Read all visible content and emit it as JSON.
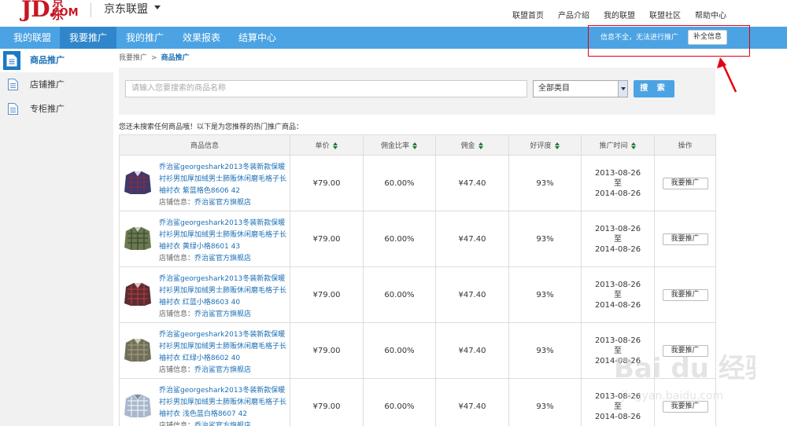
{
  "header": {
    "logo_jd": "JD.",
    "logo_cn": "京东",
    "logo_com": "COM",
    "site_title": "京东联盟",
    "links": [
      "联盟首页",
      "产品介绍",
      "我的联盟",
      "联盟社区",
      "帮助中心"
    ]
  },
  "nav": {
    "items": [
      "我的联盟",
      "我要推广",
      "我的推广",
      "效果报表",
      "结算中心"
    ],
    "active": "我要推广",
    "warning": "信息不全，无法进行推广",
    "complete_info_button": "补全信息"
  },
  "sidebar": {
    "items": [
      "商品推广",
      "店铺推广",
      "专柜推广"
    ],
    "active": "商品推广"
  },
  "breadcrumb": {
    "parent": "我要推广",
    "separator": ">",
    "current": "商品推广"
  },
  "search": {
    "placeholder": "请输入您要搜索的商品名称",
    "category": "全部类目",
    "button": "搜 索"
  },
  "hint": "您还未搜索任何商品哦！以下是为您推荐的热门推广商品：",
  "table": {
    "headers": [
      "商品信息",
      "单价",
      "佣金比率",
      "佣金",
      "好评度",
      "推广时间",
      "操作"
    ],
    "rows": [
      {
        "name": "乔治鲨georgeshark2013冬装新款保暖衬衫男加厚加绒男士肺贩休闲磨毛格子长袖衬衣 紫蓝格色8606 42",
        "store_label": "店铺信息：",
        "store": "乔治鲨官方旗舰店",
        "price": "¥79.00",
        "rate": "60.00%",
        "commission": "¥47.40",
        "rating": "93%",
        "start": "2013-08-26",
        "to": "至",
        "end": "2014-08-26",
        "action": "我要推广",
        "shirt": "purple"
      },
      {
        "name": "乔治鲨georgeshark2013冬装新款保暖衬衫男加厚加绒男士肺贩休闲磨毛格子长袖衬衣 黄绿小格8601 43",
        "store_label": "店铺信息：",
        "store": "乔治鲨官方旗舰店",
        "price": "¥79.00",
        "rate": "60.00%",
        "commission": "¥47.40",
        "rating": "93%",
        "start": "2013-08-26",
        "to": "至",
        "end": "2014-08-26",
        "action": "我要推广",
        "shirt": "green"
      },
      {
        "name": "乔治鲨georgeshark2013冬装新款保暖衬衫男加厚加绒男士肺贩休闲磨毛格子长袖衬衣 红蓝小格8603 40",
        "store_label": "店铺信息：",
        "store": "乔治鲨官方旗舰店",
        "price": "¥79.00",
        "rate": "60.00%",
        "commission": "¥47.40",
        "rating": "93%",
        "start": "2013-08-26",
        "to": "至",
        "end": "2014-08-26",
        "action": "我要推广",
        "shirt": "red"
      },
      {
        "name": "乔治鲨georgeshark2013冬装新款保暖衬衫男加厚加绒男士肺贩休闲磨毛格子长袖衬衣 红绿小格8602 40",
        "store_label": "店铺信息：",
        "store": "乔治鲨官方旗舰店",
        "price": "¥79.00",
        "rate": "60.00%",
        "commission": "¥47.40",
        "rating": "93%",
        "start": "2013-08-26",
        "to": "至",
        "end": "2014-08-26",
        "action": "我要推广",
        "shirt": "olive"
      },
      {
        "name": "乔治鲨georgeshark2013冬装新款保暖衬衫男加厚加绒男士肺贩休闲磨毛格子长袖衬衣 浅色蓝白格8607 42",
        "store_label": "店铺信息：",
        "store": "乔治鲨官方旗舰店",
        "price": "¥79.00",
        "rate": "60.00%",
        "commission": "¥47.40",
        "rating": "93%",
        "start": "2013-08-26",
        "to": "至",
        "end": "2014-08-26",
        "action": "我要推广",
        "shirt": "light"
      }
    ]
  },
  "watermark": {
    "brand": "Bai du 经验",
    "url": "jingyan.baidu.com"
  },
  "colors": {
    "nav_bg": "#4ba3e3",
    "nav_active": "#2f86cb",
    "link": "#1a6fb5",
    "brand_red": "#c81623",
    "annotation_red": "#e60012",
    "sort_green": "#1d7a3a"
  }
}
